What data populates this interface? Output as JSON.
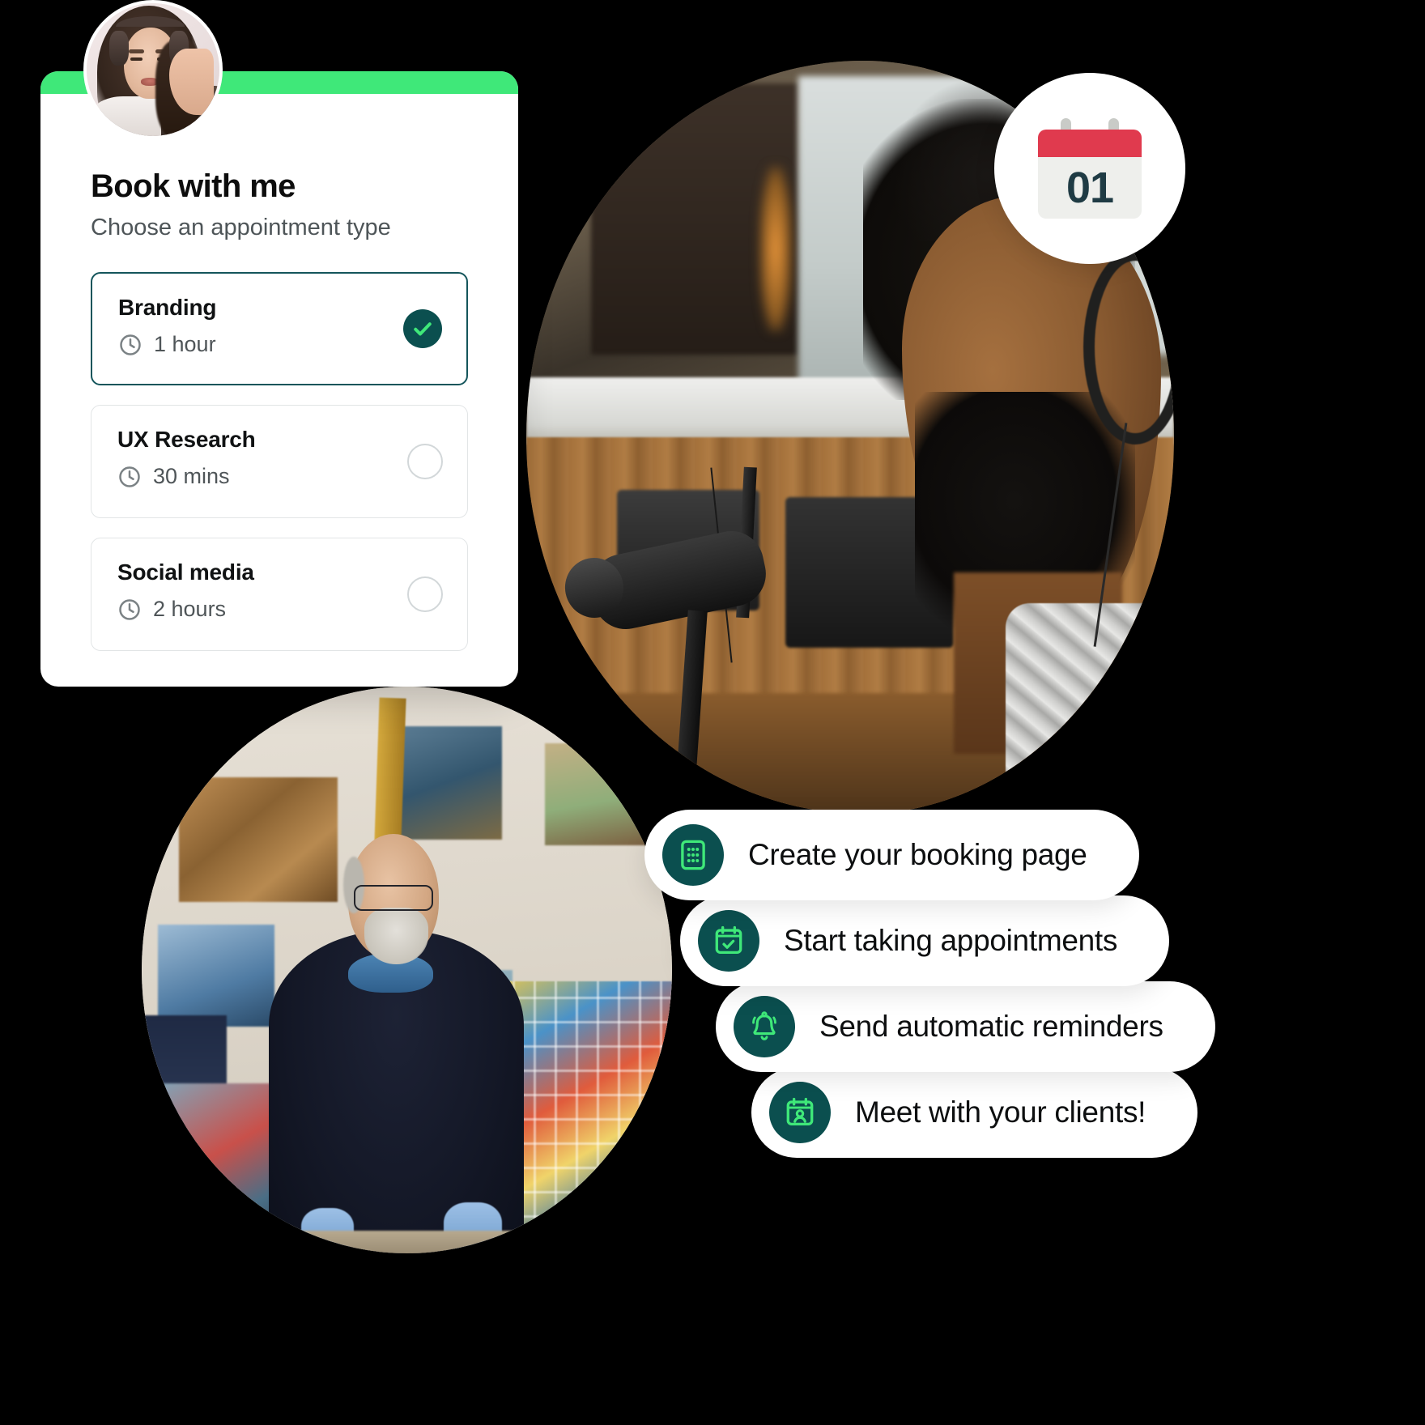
{
  "booking_card": {
    "accent_color": "#3fe879",
    "avatar": "user-avatar-photo",
    "title": "Book with me",
    "subtitle": "Choose an appointment type",
    "appointments": [
      {
        "name": "Branding",
        "duration": "1 hour",
        "selected": true,
        "icon": "clock-icon"
      },
      {
        "name": "UX Research",
        "duration": "30 mins",
        "selected": false,
        "icon": "clock-icon"
      },
      {
        "name": "Social media",
        "duration": "2 hours",
        "selected": false,
        "icon": "clock-icon"
      }
    ]
  },
  "calendar_badge": {
    "day": "01",
    "header_color": "#e03a4e",
    "body_color": "#eeefec",
    "day_color": "#1f3b44"
  },
  "feature_pills": {
    "icon_bg_color": "#0b4f4f",
    "icon_color": "#3fe879",
    "items": [
      {
        "label": "Create your booking page",
        "icon": "booking-page-icon"
      },
      {
        "label": "Start taking appointments",
        "icon": "calendar-check-icon"
      },
      {
        "label": "Send automatic reminders",
        "icon": "bell-icon"
      },
      {
        "label": "Meet with your clients!",
        "icon": "calendar-person-icon"
      }
    ]
  },
  "photos": {
    "podcaster": "podcaster-with-microphone-photo",
    "artist": "artist-in-studio-photo"
  }
}
